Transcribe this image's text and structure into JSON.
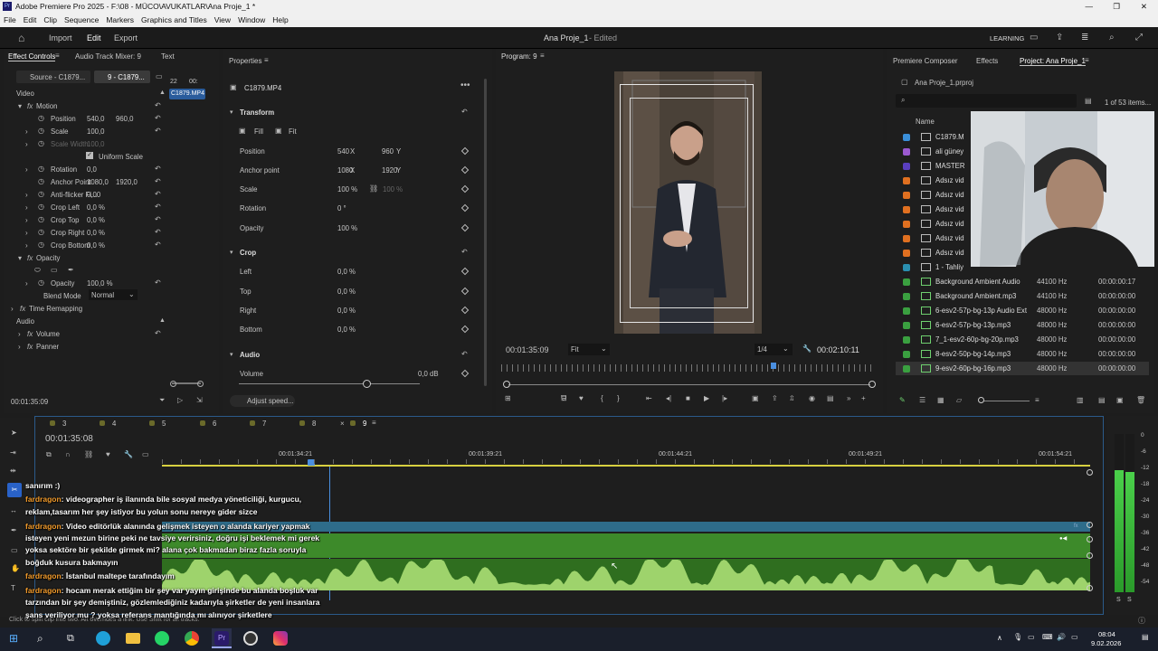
{
  "window": {
    "title": "Adobe Premiere Pro 2025 - F:\\08 - MÜCO\\AVUKATLAR\\Ana Proje_1 *"
  },
  "menu": [
    "File",
    "Edit",
    "Clip",
    "Sequence",
    "Markers",
    "Graphics and Titles",
    "View",
    "Window",
    "Help"
  ],
  "workspace": {
    "import": "Import",
    "edit": "Edit",
    "export": "Export",
    "project_title": "Ana Proje_1",
    "status": "- Edited",
    "learning": "LEARNING"
  },
  "effect_controls": {
    "tabs": [
      "Effect Controls",
      "Audio Track Mixer: 9",
      "Text"
    ],
    "source": "Source - C1879...",
    "sequence": "9 - C1879...",
    "mini_time": "22",
    "mini_time2": "00:",
    "clip_chip": "C1879.MP4",
    "video_label": "Video",
    "motion": "Motion",
    "position_label": "Position",
    "position_x": "540,0",
    "position_y": "960,0",
    "scale_label": "Scale",
    "scale_val": "100,0",
    "scale_width_label": "Scale Width",
    "scale_width_val": "100,0",
    "uniform_scale": "Uniform Scale",
    "rotation_label": "Rotation",
    "rotation_val": "0,0",
    "anchor_label": "Anchor Point",
    "anchor_x": "1080,0",
    "anchor_y": "1920,0",
    "antiflicker_label": "Anti-flicker Fi...",
    "antiflicker_val": "0,00",
    "crop_left_label": "Crop Left",
    "crop_left_val": "0,0 %",
    "crop_top_label": "Crop Top",
    "crop_top_val": "0,0 %",
    "crop_right_label": "Crop Right",
    "crop_right_val": "0,0 %",
    "crop_bottom_label": "Crop Bottom",
    "crop_bottom_val": "0,0 %",
    "opacity_group": "Opacity",
    "opacity_label": "Opacity",
    "opacity_val": "100,0 %",
    "blend_label": "Blend Mode",
    "blend_val": "Normal",
    "time_remap": "Time Remapping",
    "audio_label": "Audio",
    "volume": "Volume",
    "panner": "Panner",
    "timecode": "00:01:35:09"
  },
  "properties": {
    "header": "Properties",
    "clip": "C1879.MP4",
    "transform": "Transform",
    "fill": "Fill",
    "fit": "Fit",
    "position_label": "Position",
    "position_x": "540",
    "x_unit": "X",
    "position_y": "960",
    "y_unit": "Y",
    "anchor_label": "Anchor point",
    "anchor_x": "1080",
    "anchor_y": "1920",
    "scale_label": "Scale",
    "scale_val": "100 %",
    "scale_val2": "100 %",
    "rotation_label": "Rotation",
    "rotation_val": "0 °",
    "opacity_label": "Opacity",
    "opacity_val": "100 %",
    "crop": "Crop",
    "left_label": "Left",
    "left_val": "0,0 %",
    "top_label": "Top",
    "top_val": "0,0 %",
    "right_label": "Right",
    "right_val": "0,0 %",
    "bottom_label": "Bottom",
    "bottom_val": "0,0 %",
    "audio": "Audio",
    "volume_label": "Volume",
    "volume_val": "0,0 dB",
    "adjust_speed": "Adjust speed..."
  },
  "program": {
    "header": "Program: 9",
    "timecode": "00:01:35:09",
    "fit": "Fit",
    "quality": "1/4",
    "duration": "00:02:10:11",
    "playhead_fraction": 0.73
  },
  "project": {
    "tabs": [
      "Premiere Composer",
      "Effects",
      "Project: Ana Proje_1"
    ],
    "file": "Ana Proje_1.prproj",
    "count": "1 of 53 items...",
    "name_col": "Name",
    "items": [
      {
        "name": "C1879.M",
        "rate": "",
        "dur": "",
        "color": "#3a8fd9",
        "icon": "video"
      },
      {
        "name": "ali güney",
        "rate": "",
        "dur": "",
        "color": "#9b59d0",
        "icon": "seq"
      },
      {
        "name": "MASTER",
        "rate": "",
        "dur": "",
        "color": "#5a3fc0",
        "icon": "seq"
      },
      {
        "name": "Adsız vid",
        "rate": "",
        "dur": "",
        "color": "#e07020",
        "icon": "video"
      },
      {
        "name": "Adsız vid",
        "rate": "",
        "dur": "",
        "color": "#e07020",
        "icon": "video"
      },
      {
        "name": "Adsız vid",
        "rate": "",
        "dur": "",
        "color": "#e07020",
        "icon": "video"
      },
      {
        "name": "Adsız vid",
        "rate": "",
        "dur": "",
        "color": "#e07020",
        "icon": "video"
      },
      {
        "name": "Adsız vid",
        "rate": "",
        "dur": "",
        "color": "#e07020",
        "icon": "video"
      },
      {
        "name": "Adsız vid",
        "rate": "",
        "dur": "",
        "color": "#e07020",
        "icon": "video"
      },
      {
        "name": "1 - Tahliy",
        "rate": "",
        "dur": "",
        "color": "#2a8fb0",
        "icon": "seq"
      },
      {
        "name": "Background Ambient Audio",
        "rate": "44100 Hz",
        "dur": "00:00:00:17",
        "color": "#3aa040",
        "icon": "audio"
      },
      {
        "name": "Background Ambient.mp3",
        "rate": "44100 Hz",
        "dur": "00:00:00:00",
        "color": "#3aa040",
        "icon": "audio"
      },
      {
        "name": "6-esv2-57p-bg-13p Audio Ext",
        "rate": "48000 Hz",
        "dur": "00:00:00:00",
        "color": "#3aa040",
        "icon": "audio"
      },
      {
        "name": "6-esv2-57p-bg-13p.mp3",
        "rate": "48000 Hz",
        "dur": "00:00:00:00",
        "color": "#3aa040",
        "icon": "audio"
      },
      {
        "name": "7_1-esv2-60p-bg-20p.mp3",
        "rate": "48000 Hz",
        "dur": "00:00:00:00",
        "color": "#3aa040",
        "icon": "audio"
      },
      {
        "name": "8-esv2-50p-bg-14p.mp3",
        "rate": "48000 Hz",
        "dur": "00:00:00:00",
        "color": "#3aa040",
        "icon": "audio"
      },
      {
        "name": "9-esv2-60p-bg-16p.mp3",
        "rate": "48000 Hz",
        "dur": "00:00:00:00",
        "color": "#3aa040",
        "icon": "audio"
      }
    ]
  },
  "timeline": {
    "seq_tabs": [
      "3",
      "4",
      "5",
      "6",
      "7",
      "8",
      "9"
    ],
    "timecode": "00:01:35:08",
    "ruler": [
      "00:01:34:21",
      "00:01:39:21",
      "00:01:44:21",
      "00:01:49:21",
      "00:01:54:21"
    ],
    "status": "Click to split clip into two. Alt overrides a link. Use Shift for all tracks."
  },
  "meter": {
    "labels": [
      "0",
      "-6",
      "-12",
      "-18",
      "-24",
      "-30",
      "-36",
      "-42",
      "-48",
      "-54"
    ],
    "s1": "S",
    "s2": "S"
  },
  "chat": [
    {
      "user": "",
      "text": "sanırım :)"
    },
    {
      "user": "fardragon",
      "text": ": videographer iş ilanında bile sosyal medya yöneticiliği, kurgucu,"
    },
    {
      "user": "",
      "text": "reklam,tasarım her şey istiyor bu yolun sonu nereye gider sizce"
    },
    {
      "user": "fardragon",
      "text": ": Video editörlük alanında gelişmek isteyen o alanda kariyer yapmak"
    },
    {
      "user": "",
      "text": "isteyen yeni mezun birine peki ne tavsiye verirsiniz, doğru işi beklemek mi gerek"
    },
    {
      "user": "",
      "text": "yoksa sektöre bir şekilde girmek mi? alana çok bakmadan biraz fazla soruyla"
    },
    {
      "user": "",
      "text": "boğduk kusura bakmayın"
    },
    {
      "user": "fardragon",
      "text": ": İstanbul maltepe tarafındayım"
    },
    {
      "user": "fardragon",
      "text": ": hocam merak ettiğim bir şey var yayın girişinde bu alanda boşluk var"
    },
    {
      "user": "",
      "text": "tarzından bir şey demiştiniz, gözlemlediğiniz kadarıyla şirketler de yeni insanlara"
    },
    {
      "user": "",
      "text": "şans veriliyor mu ? yoksa referans mantığında mı alınıyor şirketlere"
    }
  ],
  "tray": {
    "time": "08:04",
    "date": "9.02.2026"
  }
}
